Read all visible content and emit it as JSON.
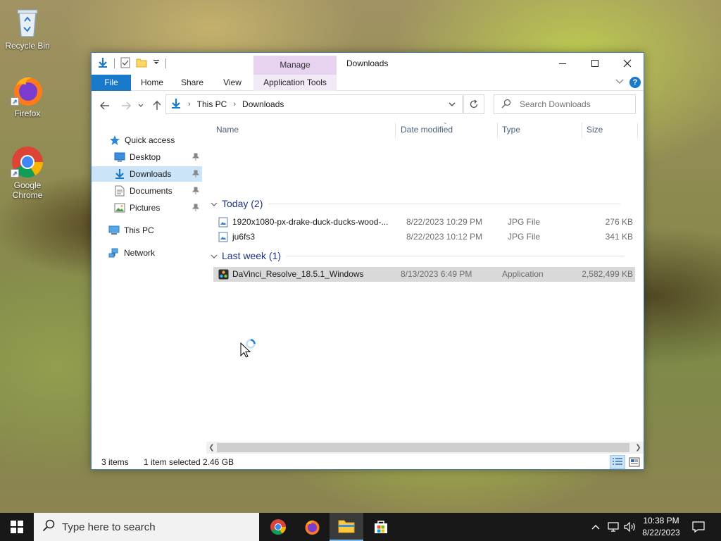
{
  "desktop": {
    "icons": [
      {
        "label": "Recycle Bin",
        "icon": "recycle-bin-icon"
      },
      {
        "label": "Firefox",
        "icon": "firefox-icon"
      },
      {
        "label": "Google Chrome",
        "icon": "chrome-icon"
      }
    ]
  },
  "window": {
    "title": "Downloads",
    "contextual_tab": "Manage",
    "ribbon_tabs": [
      "File",
      "Home",
      "Share",
      "View",
      "Application Tools"
    ],
    "breadcrumb": [
      "This PC",
      "Downloads"
    ],
    "search_placeholder": "Search Downloads",
    "accent_color": "#1979ca"
  },
  "nav_pane": {
    "quick_access": "Quick access",
    "items": [
      {
        "label": "Desktop",
        "pinned": true
      },
      {
        "label": "Downloads",
        "pinned": true,
        "selected": true
      },
      {
        "label": "Documents",
        "pinned": true
      },
      {
        "label": "Pictures",
        "pinned": true
      }
    ],
    "this_pc": "This PC",
    "network": "Network"
  },
  "file_list": {
    "columns": [
      "Name",
      "Date modified",
      "Type",
      "Size"
    ],
    "groups": [
      {
        "label": "Today (2)",
        "files": [
          {
            "name": "1920x1080-px-drake-duck-ducks-wood-...",
            "date": "8/22/2023 10:29 PM",
            "type": "JPG File",
            "size": "276 KB"
          },
          {
            "name": "ju6fs3",
            "date": "8/22/2023 10:12 PM",
            "type": "JPG File",
            "size": "341 KB"
          }
        ]
      },
      {
        "label": "Last week (1)",
        "files": [
          {
            "name": "DaVinci_Resolve_18.5.1_Windows",
            "date": "8/13/2023 6:49 PM",
            "type": "Application",
            "size": "2,582,499 KB",
            "selected": true
          }
        ]
      }
    ]
  },
  "status_bar": {
    "item_count": "3 items",
    "selection": "1 item selected",
    "selection_size": "2.46 GB"
  },
  "taskbar": {
    "search_placeholder": "Type here to search",
    "time": "10:38 PM",
    "date": "8/22/2023"
  }
}
